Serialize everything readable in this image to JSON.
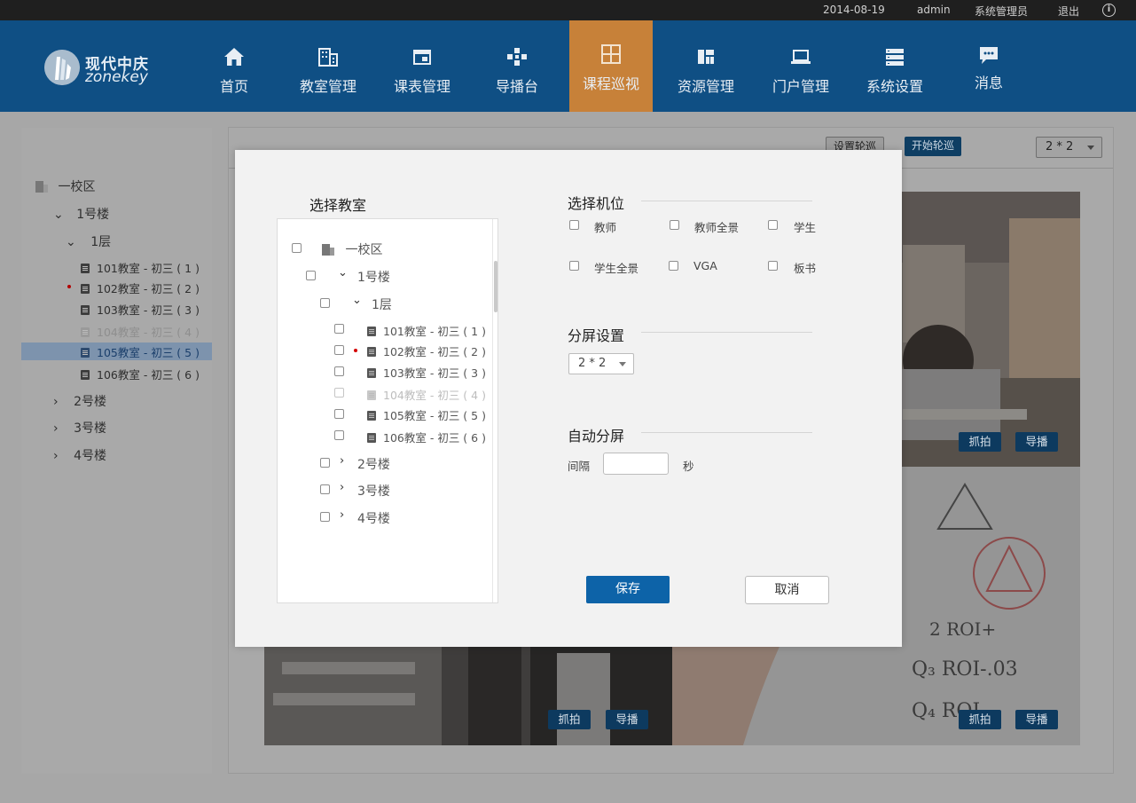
{
  "topbar": {
    "date": "2014-08-19",
    "user": "admin",
    "role": "系统管理员",
    "logout": "退出",
    "info_icon": "info-icon"
  },
  "logo": {
    "line1": "现代中庆",
    "line2": "zonekey"
  },
  "nav": [
    {
      "label": "首页",
      "icon": "home-icon"
    },
    {
      "label": "教室管理",
      "icon": "building-icon"
    },
    {
      "label": "课表管理",
      "icon": "schedule-icon"
    },
    {
      "label": "导播台",
      "icon": "gamepad-icon"
    },
    {
      "label": "课程巡视",
      "icon": "grid-icon",
      "active": true
    },
    {
      "label": "资源管理",
      "icon": "resource-icon"
    },
    {
      "label": "门户管理",
      "icon": "laptop-icon"
    },
    {
      "label": "系统设置",
      "icon": "server-icon"
    },
    {
      "label": "消息",
      "icon": "message-icon"
    }
  ],
  "left_tree": {
    "campus": "一校区",
    "building1": "1号楼",
    "floor1": "1层",
    "rooms": [
      "101教室 - 初三 ( 1 )",
      "102教室 - 初三 ( 2 )",
      "103教室 - 初三 ( 3 )",
      "104教室 - 初三 ( 4 )",
      "105教室 - 初三 ( 5 )",
      "106教室 - 初三 ( 6 )"
    ],
    "building2": "2号楼",
    "building3": "3号楼",
    "building4": "4号楼"
  },
  "right_panel": {
    "set_patrol": "设置轮巡",
    "start_patrol": "开始轮巡",
    "layout_select": "2 * 2",
    "capture": "抓拍",
    "broadcast": "导播"
  },
  "modal": {
    "select_classroom": "选择教室",
    "select_position": "选择机位",
    "tree": {
      "campus": "一校区",
      "building1": "1号楼",
      "floor1": "1层",
      "rooms": [
        "101教室 - 初三 ( 1 )",
        "102教室 - 初三 ( 2 )",
        "103教室 - 初三 ( 3 )",
        "104教室 - 初三 ( 4 )",
        "105教室 - 初三 ( 5 )",
        "106教室 - 初三 ( 6 )"
      ],
      "building2": "2号楼",
      "building3": "3号楼",
      "building4": "4号楼"
    },
    "positions": [
      "教师",
      "教师全景",
      "学生",
      "学生全景",
      "VGA",
      "板书"
    ],
    "split_settings": "分屏设置",
    "split_value": "2 * 2",
    "auto_split": "自动分屏",
    "interval_label": "间隔",
    "interval_value": "",
    "seconds_label": "秒",
    "save": "保存",
    "cancel": "取消"
  }
}
